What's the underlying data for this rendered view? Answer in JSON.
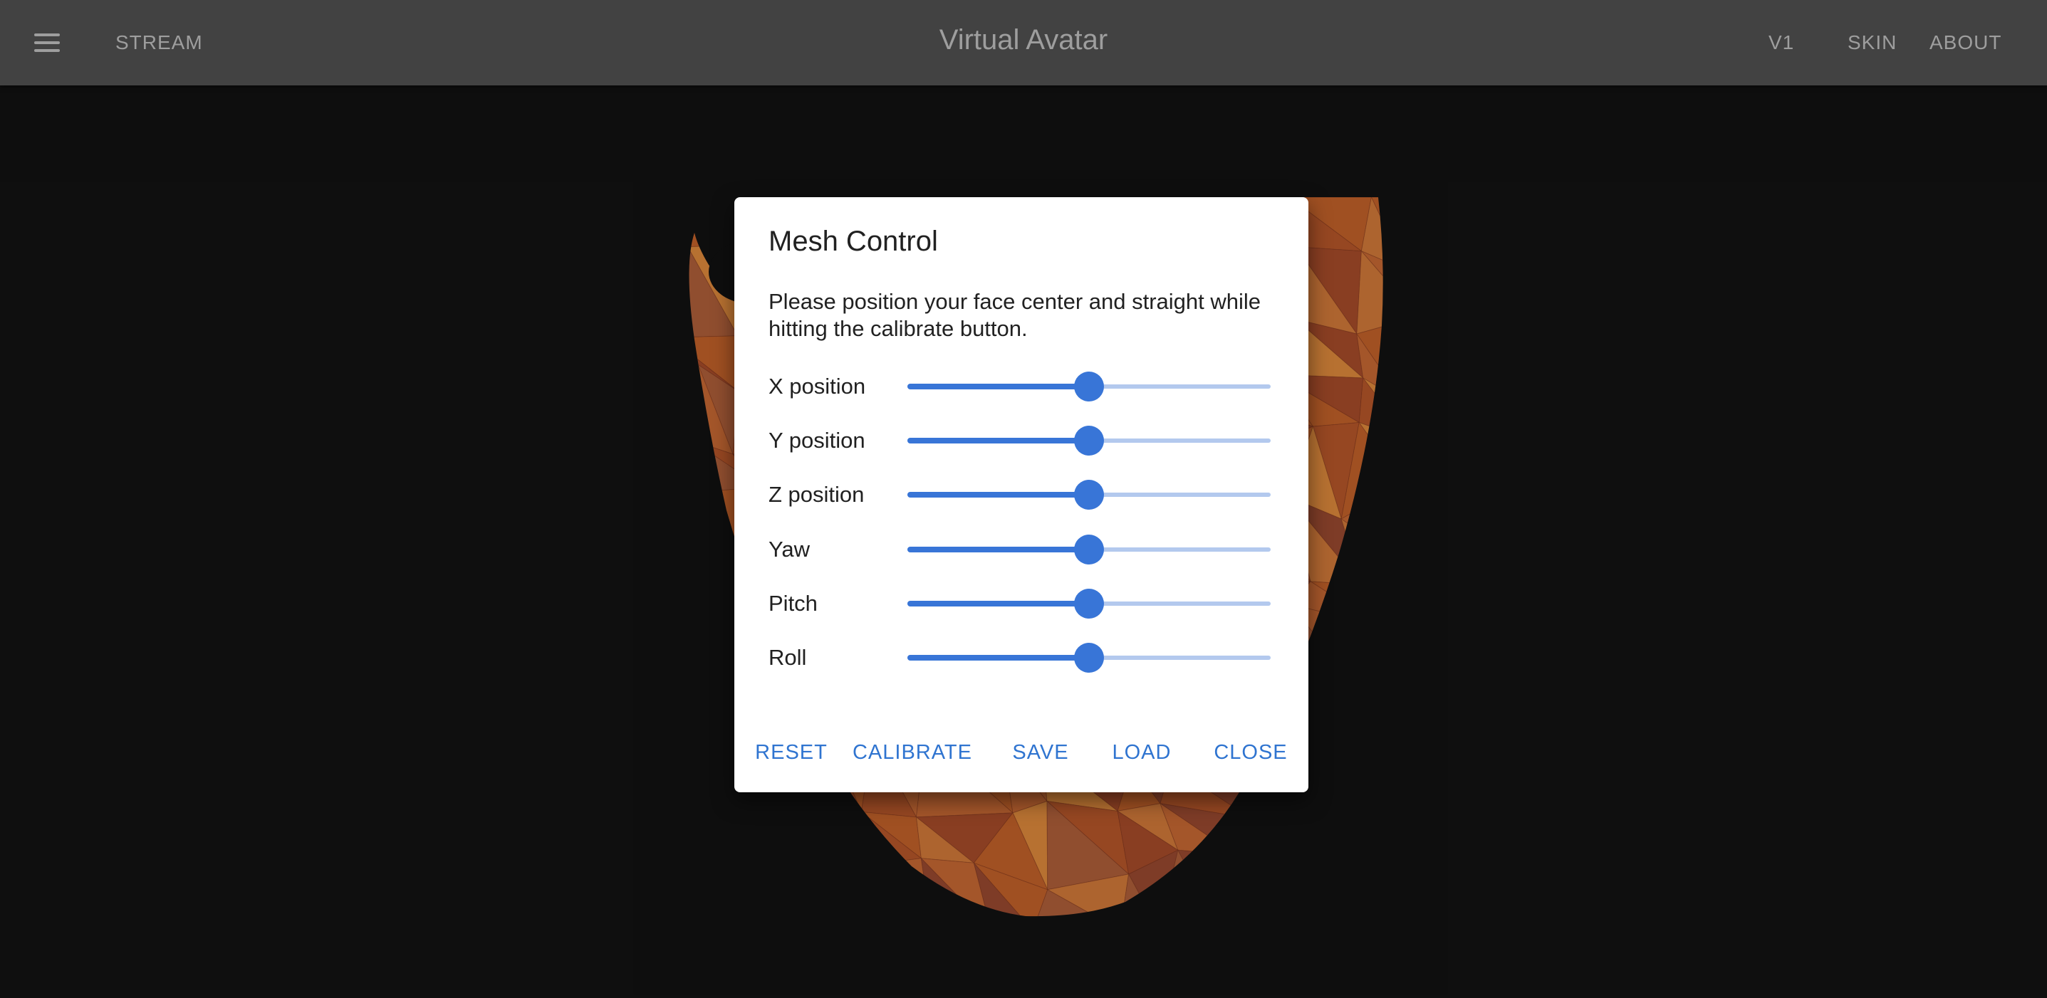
{
  "appbar": {
    "menu_icon": "hamburger-menu-icon",
    "stream_label": "STREAM",
    "title": "Virtual Avatar",
    "v1_label": "V1",
    "skin_label": "SKIN",
    "about_label": "ABOUT",
    "background_color": "#424242",
    "text_color": "#9e9e9e"
  },
  "dialog": {
    "title": "Mesh Control",
    "description": "Please position your face center and straight while hitting the calibrate button.",
    "sliders": [
      {
        "label": "X position",
        "value": 0.5
      },
      {
        "label": "Y position",
        "value": 0.5
      },
      {
        "label": "Z position",
        "value": 0.5
      },
      {
        "label": "Yaw",
        "value": 0.5
      },
      {
        "label": "Pitch",
        "value": 0.5
      },
      {
        "label": "Roll",
        "value": 0.5
      }
    ],
    "actions": {
      "reset_label": "RESET",
      "calibrate_label": "CALIBRATE",
      "save_label": "SAVE",
      "load_label": "LOAD",
      "close_label": "CLOSE"
    },
    "accent_color": "#3875d7"
  },
  "avatar": {
    "mesh_colors": [
      "#c4622a",
      "#b8572a",
      "#d47a3a",
      "#a84c2a",
      "#e08a3c",
      "#9a4a30",
      "#c96a34",
      "#b0603a"
    ]
  }
}
